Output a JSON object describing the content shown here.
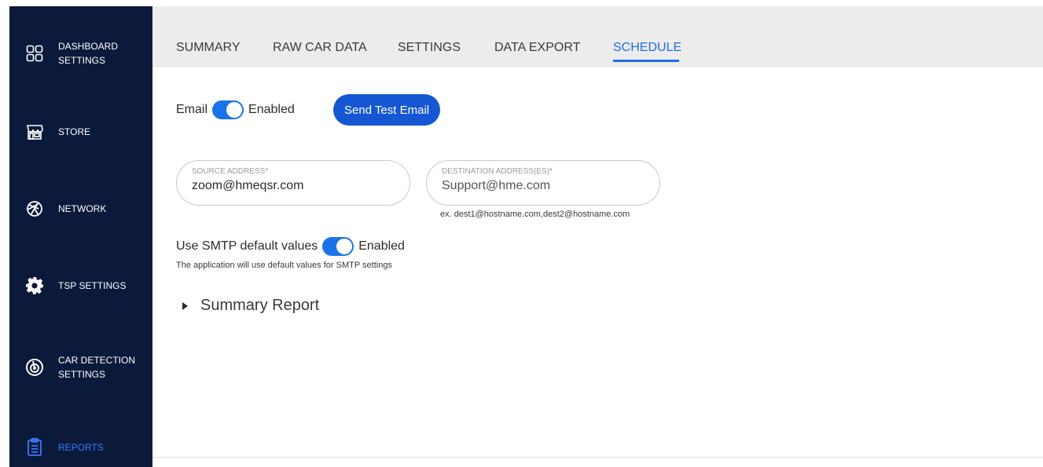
{
  "sidebar": {
    "items": [
      {
        "label_line1": "DASHBOARD",
        "label_line2": "SETTINGS",
        "icon": "dashboard-grid-icon"
      },
      {
        "label_line1": "STORE",
        "label_line2": "",
        "icon": "store-icon"
      },
      {
        "label_line1": "NETWORK",
        "label_line2": "",
        "icon": "network-globe-icon"
      },
      {
        "label_line1": "TSP SETTINGS",
        "label_line2": "",
        "icon": "gear-icon"
      },
      {
        "label_line1": "CAR DETECTION",
        "label_line2": "SETTINGS",
        "icon": "car-detection-icon"
      },
      {
        "label_line1": "REPORTS",
        "label_line2": "",
        "icon": "clipboard-icon"
      }
    ],
    "active_index": 5
  },
  "tabs": [
    {
      "label": "SUMMARY"
    },
    {
      "label": "RAW CAR DATA"
    },
    {
      "label": "SETTINGS"
    },
    {
      "label": "DATA EXPORT"
    },
    {
      "label": "SCHEDULE"
    }
  ],
  "active_tab": "SCHEDULE",
  "email": {
    "label": "Email",
    "toggle_state": "Enabled",
    "send_test_label": "Send Test Email"
  },
  "source": {
    "label": "SOURCE ADDRESS*",
    "value": "zoom@hmeqsr.com"
  },
  "destination": {
    "label": "DESTINATION ADDRESS(ES)*",
    "value": "Support@hme.com",
    "hint": "ex. dest1@hostname.com,dest2@hostname.com"
  },
  "smtp": {
    "label": "Use SMTP default values",
    "toggle_state": "Enabled",
    "note": "The application will use default values for SMTP settings"
  },
  "summary_report": {
    "label": "Summary Report"
  },
  "colors": {
    "sidebar_bg": "#0b1a3a",
    "accent": "#1f6fe0",
    "button_bg": "#1557d3",
    "topbar_bg": "#ececec"
  }
}
